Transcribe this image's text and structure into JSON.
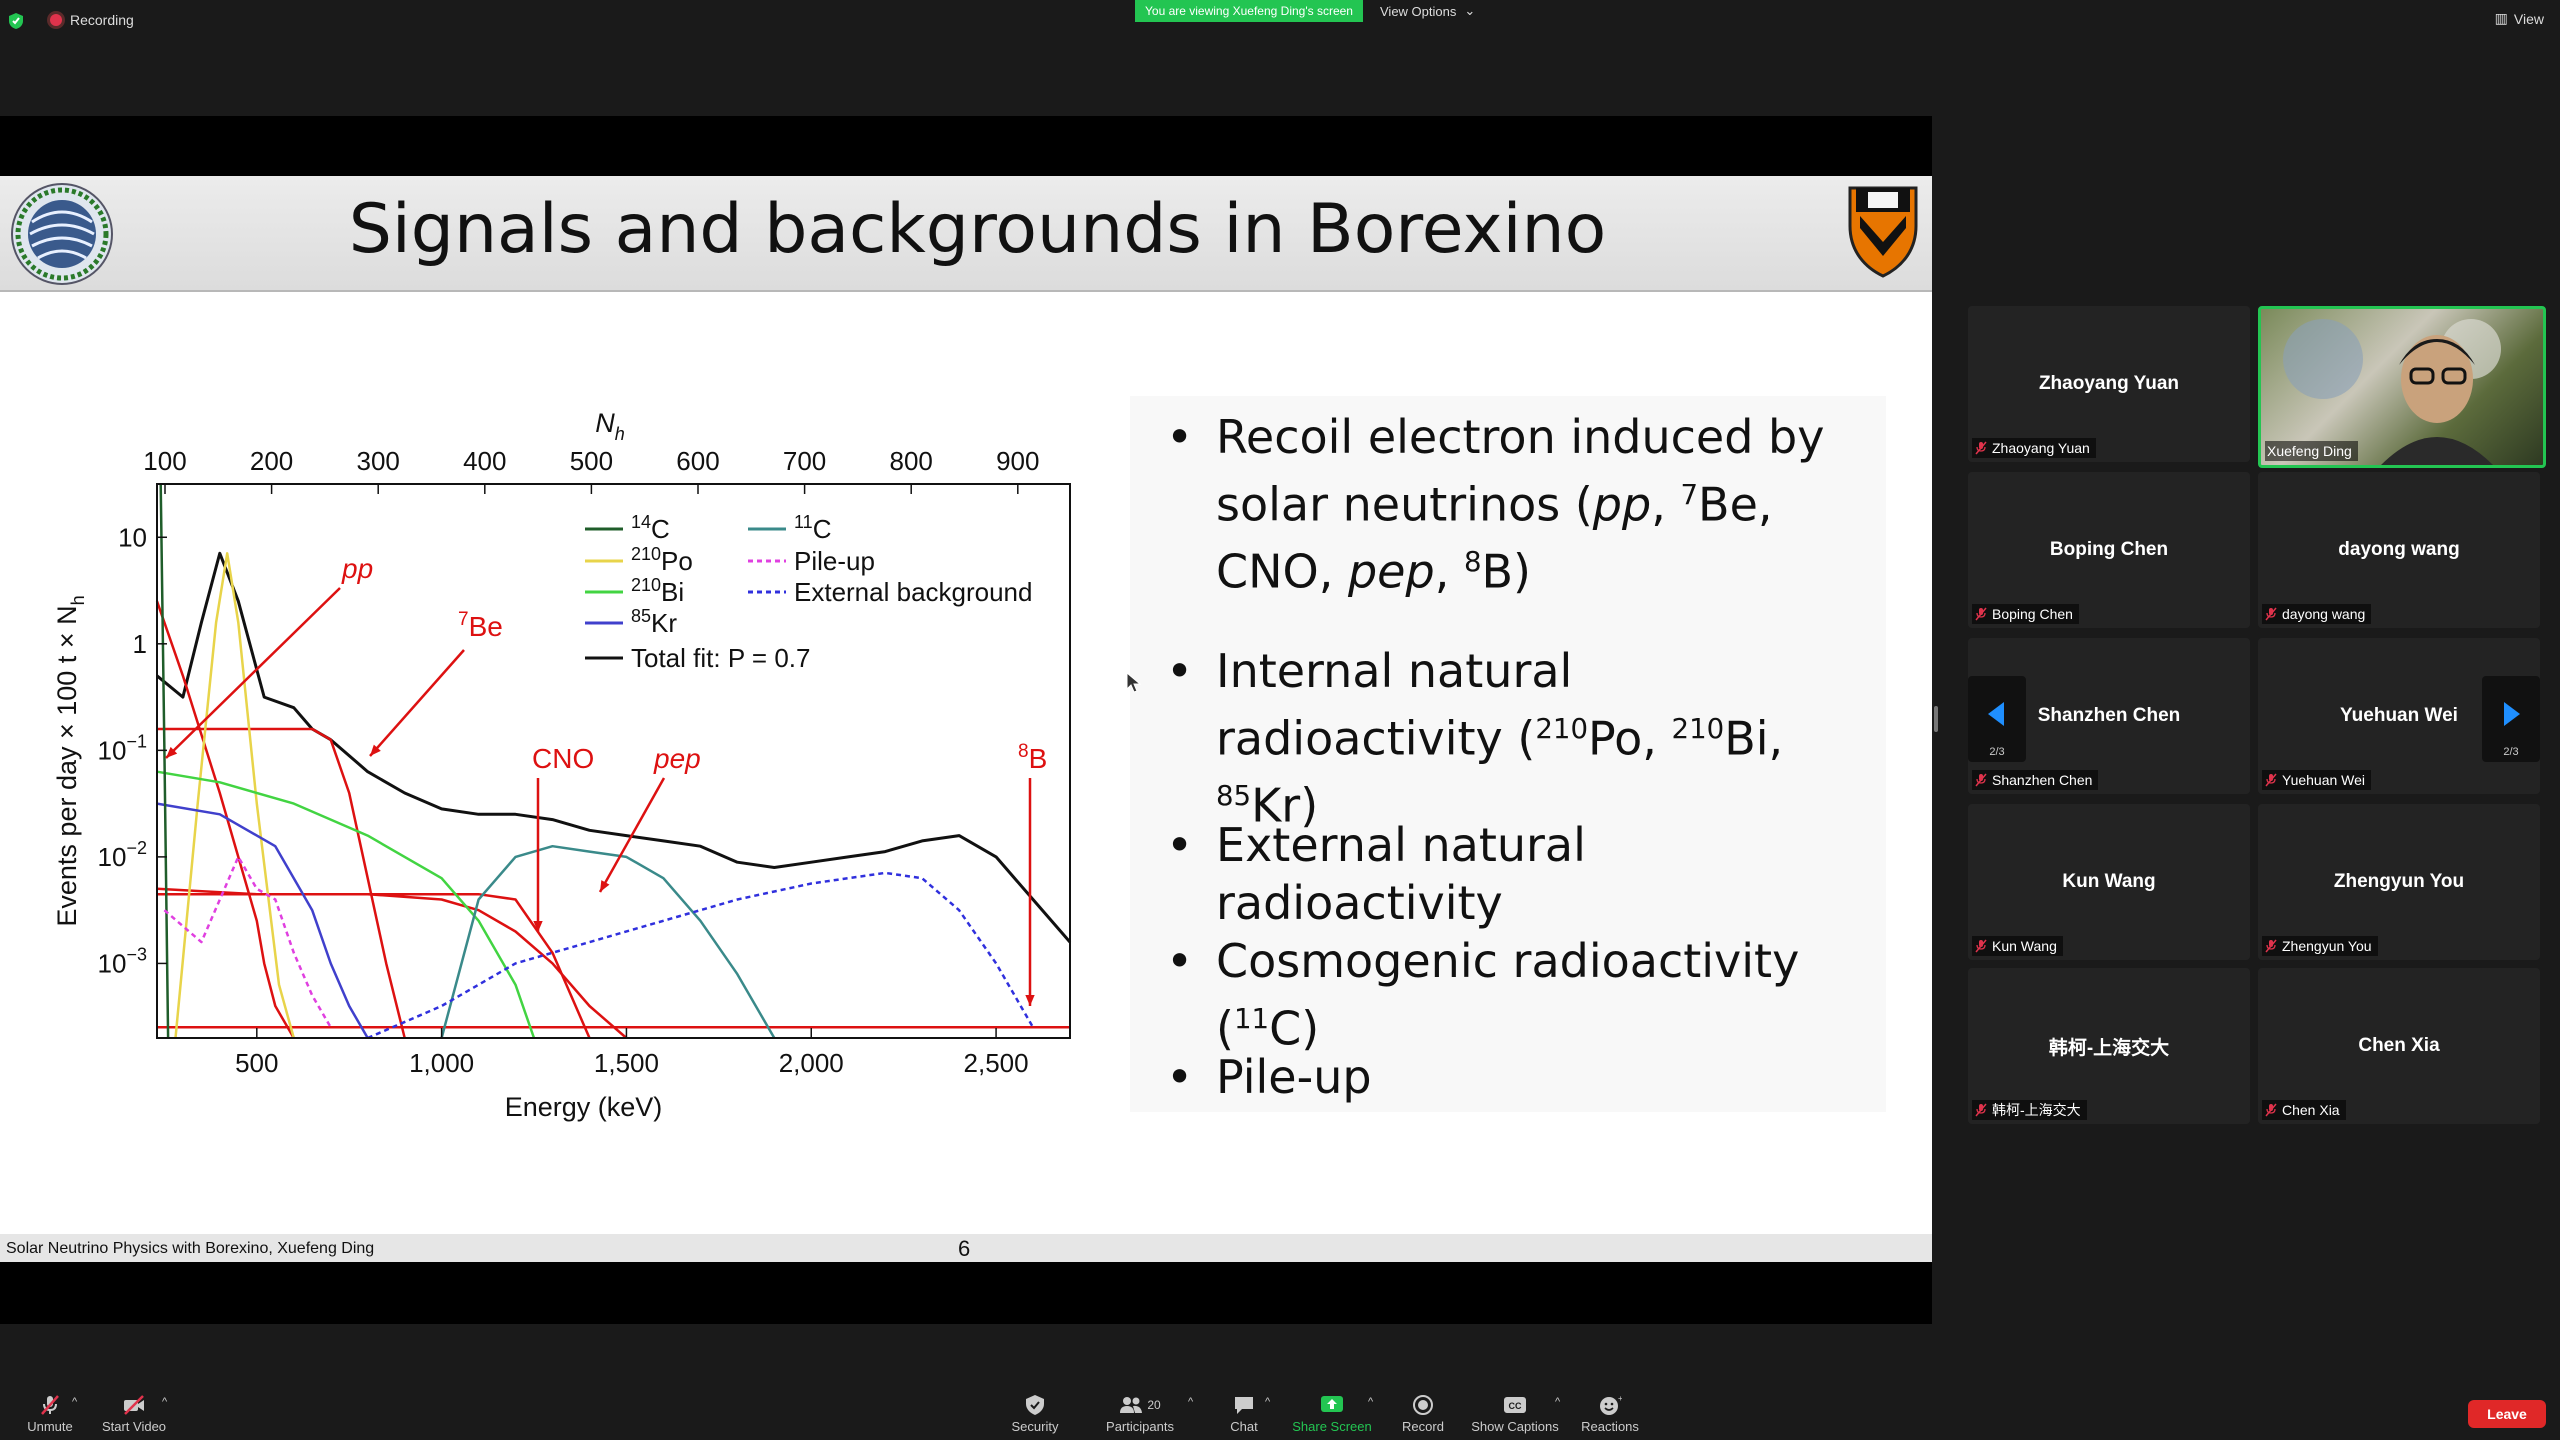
{
  "top_bar": {
    "recording": "Recording",
    "viewing_banner": "You are viewing Xuefeng Ding's screen",
    "view_options": "View Options",
    "view": "View"
  },
  "slide": {
    "title": "Signals and backgrounds in Borexino",
    "footer": "Solar Neutrino Physics with Borexino, Xuefeng Ding",
    "page": "6",
    "bullets": [
      {
        "parts": [
          "Recoil electron induced by solar neutrinos (",
          "pp",
          ", ",
          "7",
          "Be, CNO, ",
          "pep",
          ", ",
          "8",
          "B)"
        ]
      },
      {
        "parts": [
          "Internal natural radioactivity (",
          "210",
          "Po, ",
          "210",
          "Bi, ",
          "85",
          "Kr)"
        ]
      },
      {
        "parts": [
          "External natural radioactivity"
        ]
      },
      {
        "parts": [
          "Cosmogenic radioactivity (",
          "11",
          "C)"
        ]
      },
      {
        "parts": [
          "Pile-up"
        ]
      }
    ]
  },
  "chart_data": {
    "type": "line",
    "xlabel": "Energy (keV)",
    "x2label": "N",
    "x2label_sub": "h",
    "ylabel": "Events per day × 100 t × N",
    "ylabel_sub": "h",
    "x_ticks": [
      "500",
      "1,000",
      "1,500",
      "2,000",
      "2,500"
    ],
    "x_tick_values": [
      500,
      1000,
      1500,
      2000,
      2500
    ],
    "x2_ticks": [
      "100",
      "200",
      "300",
      "400",
      "500",
      "600",
      "700",
      "800",
      "900"
    ],
    "y_ticks": [
      {
        "base": "10",
        "exp": ""
      },
      {
        "base": "1",
        "exp": ""
      },
      {
        "base": "10",
        "exp": "−1"
      },
      {
        "base": "10",
        "exp": "−2"
      },
      {
        "base": "10",
        "exp": "−3"
      }
    ],
    "y_log_values": [
      1,
      0,
      -1,
      -2,
      -3
    ],
    "xlim": [
      230,
      2700
    ],
    "ylim_log": [
      -3.7,
      1.5
    ],
    "legend": [
      {
        "sup": "14",
        "label": "C",
        "color": "#1f5d2a",
        "dash": false
      },
      {
        "sup": "210",
        "label": "Po",
        "color": "#e8d44a",
        "dash": false
      },
      {
        "sup": "210",
        "label": "Bi",
        "color": "#42d442",
        "dash": false
      },
      {
        "sup": "85",
        "label": "Kr",
        "color": "#4040cc",
        "dash": false
      },
      {
        "sup": "",
        "label": "Total fit: P = 0.7",
        "color": "#111111",
        "dash": false
      },
      {
        "sup": "11",
        "label": "C",
        "color": "#3a8a8a",
        "dash": false
      },
      {
        "sup": "",
        "label": "Pile-up",
        "color": "#e040e0",
        "dash": true
      },
      {
        "sup": "",
        "label": "External background",
        "color": "#3030dd",
        "dash": true
      }
    ],
    "annotations": [
      {
        "sup": "",
        "text": "pp",
        "italic": true
      },
      {
        "sup": "7",
        "text": "Be",
        "italic": false
      },
      {
        "sup": "",
        "text": "CNO",
        "italic": false
      },
      {
        "sup": "",
        "text": "pep",
        "italic": true
      },
      {
        "sup": "8",
        "text": "B",
        "italic": false
      }
    ],
    "series": [
      {
        "name": "Total fit",
        "color": "#111111",
        "x": [
          230,
          300,
          350,
          400,
          450,
          520,
          600,
          650,
          700,
          800,
          900,
          1000,
          1100,
          1200,
          1300,
          1400,
          1500,
          1600,
          1700,
          1800,
          1900,
          2000,
          2100,
          2200,
          2300,
          2400,
          2500,
          2600,
          2700
        ],
        "y": [
          -0.3,
          -0.5,
          0.2,
          0.85,
          0.4,
          -0.5,
          -0.6,
          -0.8,
          -0.9,
          -1.2,
          -1.4,
          -1.55,
          -1.6,
          -1.6,
          -1.65,
          -1.75,
          -1.8,
          -1.85,
          -1.9,
          -2.05,
          -2.1,
          -2.05,
          -2.0,
          -1.95,
          -1.85,
          -1.8,
          -2.0,
          -2.4,
          -2.8
        ]
      },
      {
        "name": "pp",
        "color": "#dd1111",
        "x": [
          230,
          300,
          400,
          500,
          520,
          550,
          600
        ],
        "y": [
          0.4,
          -0.3,
          -1.4,
          -2.6,
          -3.0,
          -3.4,
          -3.7
        ]
      },
      {
        "name": "7Be",
        "color": "#dd1111",
        "x": [
          230,
          300,
          400,
          500,
          600,
          650,
          700,
          750,
          800,
          850,
          900
        ],
        "y": [
          -0.8,
          -0.8,
          -0.8,
          -0.8,
          -0.8,
          -0.8,
          -0.9,
          -1.4,
          -2.2,
          -3.0,
          -3.7
        ]
      },
      {
        "name": "CNO",
        "color": "#dd1111",
        "x": [
          230,
          500,
          800,
          1000,
          1100,
          1200,
          1300,
          1400,
          1500
        ],
        "y": [
          -2.3,
          -2.35,
          -2.35,
          -2.4,
          -2.5,
          -2.7,
          -3.0,
          -3.4,
          -3.7
        ]
      },
      {
        "name": "pep",
        "color": "#dd1111",
        "x": [
          230,
          600,
          900,
          1000,
          1100,
          1200,
          1300,
          1400
        ],
        "y": [
          -2.35,
          -2.35,
          -2.35,
          -2.35,
          -2.35,
          -2.4,
          -2.9,
          -3.7
        ]
      },
      {
        "name": "8B",
        "color": "#dd1111",
        "x": [
          230,
          1000,
          2000,
          2700
        ],
        "y": [
          -3.6,
          -3.6,
          -3.6,
          -3.6
        ]
      },
      {
        "name": "210Po",
        "color": "#e8d44a",
        "x": [
          280,
          340,
          390,
          420,
          450,
          500,
          560,
          600
        ],
        "y": [
          -3.7,
          -1.5,
          0.2,
          0.85,
          0.2,
          -1.5,
          -3.2,
          -3.7
        ]
      },
      {
        "name": "210Bi",
        "color": "#42d442",
        "x": [
          230,
          400,
          600,
          800,
          1000,
          1100,
          1200,
          1250
        ],
        "y": [
          -1.2,
          -1.3,
          -1.5,
          -1.8,
          -2.2,
          -2.6,
          -3.2,
          -3.7
        ]
      },
      {
        "name": "85Kr",
        "color": "#4040cc",
        "x": [
          230,
          400,
          550,
          650,
          700,
          750,
          800
        ],
        "y": [
          -1.5,
          -1.6,
          -1.9,
          -2.5,
          -3.0,
          -3.4,
          -3.7
        ]
      },
      {
        "name": "11C",
        "color": "#3a8a8a",
        "x": [
          1000,
          1100,
          1200,
          1300,
          1400,
          1500,
          1600,
          1700,
          1800,
          1900
        ],
        "y": [
          -3.7,
          -2.4,
          -2.0,
          -1.9,
          -1.95,
          -2.0,
          -2.2,
          -2.6,
          -3.1,
          -3.7
        ]
      },
      {
        "name": "14C",
        "color": "#1f5d2a",
        "x": [
          240,
          250,
          260
        ],
        "y": [
          1.5,
          -1.0,
          -3.7
        ]
      },
      {
        "name": "Pile-up",
        "color": "#e040e0",
        "x": [
          250,
          350,
          450,
          500,
          550,
          600,
          650,
          700
        ],
        "y": [
          -2.5,
          -2.8,
          -2.0,
          -2.3,
          -2.4,
          -2.9,
          -3.3,
          -3.6
        ]
      },
      {
        "name": "External background",
        "color": "#3030dd",
        "x": [
          800,
          1000,
          1200,
          1400,
          1600,
          1800,
          2000,
          2200,
          2300,
          2400,
          2500,
          2600
        ],
        "y": [
          -3.7,
          -3.4,
          -3.0,
          -2.8,
          -2.6,
          -2.4,
          -2.25,
          -2.15,
          -2.2,
          -2.5,
          -3.0,
          -3.6
        ]
      }
    ]
  },
  "gallery": [
    {
      "name": "Zhaoyang Yuan",
      "label": "Zhaoyang Yuan",
      "video": false
    },
    {
      "name": "",
      "label": "Xuefeng Ding",
      "video": true
    },
    {
      "name": "Boping Chen",
      "label": "Boping Chen",
      "video": false
    },
    {
      "name": "dayong wang",
      "label": "dayong wang",
      "video": false
    },
    {
      "name": "Shanzhen Chen",
      "label": "Shanzhen Chen",
      "video": false
    },
    {
      "name": "Yuehuan Wei",
      "label": "Yuehuan Wei",
      "video": false
    },
    {
      "name": "Kun Wang",
      "label": "Kun Wang",
      "video": false
    },
    {
      "name": "Zhengyun You",
      "label": "Zhengyun You",
      "video": false
    },
    {
      "name": "韩柯-上海交大",
      "label": "韩柯-上海交大",
      "video": false
    },
    {
      "name": "Chen Xia",
      "label": "Chen Xia",
      "video": false
    }
  ],
  "gallery_page": "2/3",
  "toolbar": {
    "unmute": "Unmute",
    "start_video": "Start Video",
    "security": "Security",
    "participants": "Participants",
    "participants_count": "20",
    "chat": "Chat",
    "share_screen": "Share Screen",
    "record": "Record",
    "show_captions": "Show Captions",
    "reactions": "Reactions",
    "leave": "Leave"
  },
  "colors": {
    "accent_green": "#23c552",
    "leave_red": "#e02828",
    "share_green": "#23c552",
    "background": "#1a1a1a"
  }
}
